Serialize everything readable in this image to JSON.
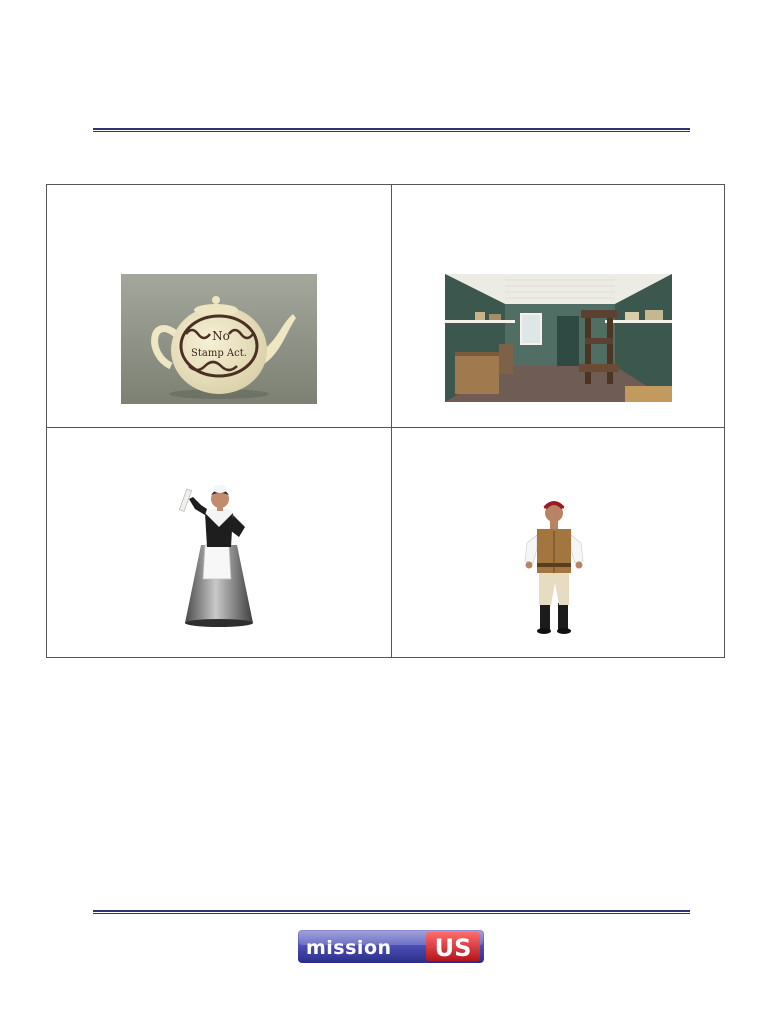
{
  "images": {
    "teapot": {
      "inscription_line1": "No",
      "inscription_line2": "Stamp Act."
    },
    "print_shop": {},
    "woman": {},
    "man": {}
  },
  "footer": {
    "logo_part1": "mission",
    "logo_part2": "US"
  }
}
